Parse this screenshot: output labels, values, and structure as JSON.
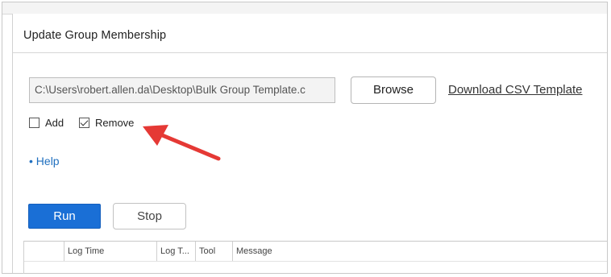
{
  "panel": {
    "title": "Update Group Membership"
  },
  "file": {
    "path_value": "C:\\Users\\robert.allen.da\\Desktop\\Bulk Group Template.c",
    "browse_label": "Browse",
    "download_link": "Download CSV Template"
  },
  "options": {
    "add_label": "Add",
    "add_checked": false,
    "remove_label": "Remove",
    "remove_checked": true
  },
  "help": {
    "label": "• Help"
  },
  "actions": {
    "run_label": "Run",
    "stop_label": "Stop",
    "run_color": "#1a6fd6"
  },
  "log": {
    "columns": [
      "",
      "Log Time",
      "Log T...",
      "Tool",
      "Message"
    ]
  },
  "annotation": {
    "arrow_color": "#e53935"
  }
}
